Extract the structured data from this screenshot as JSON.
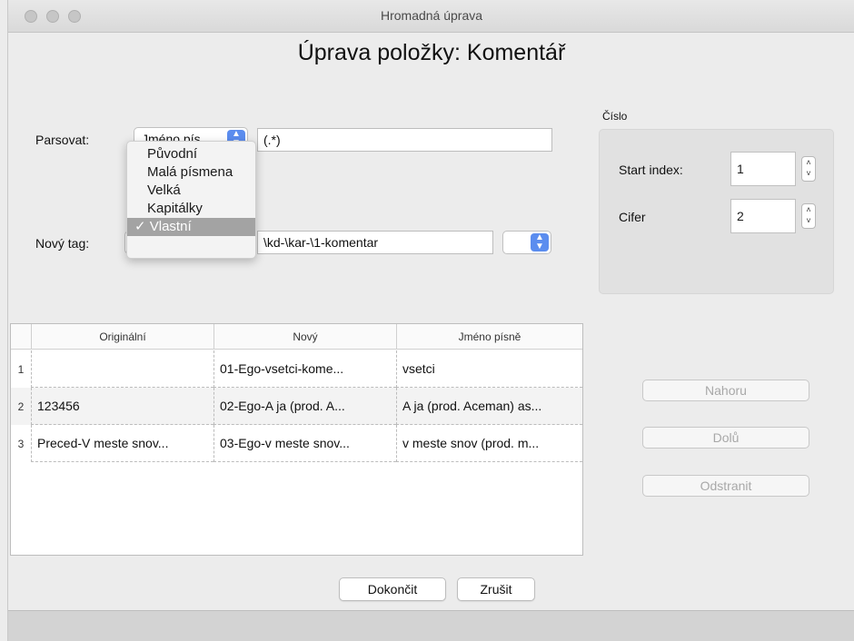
{
  "window": {
    "title": "Hromadná úprava"
  },
  "heading": "Úprava položky: Komentář",
  "parse": {
    "label": "Parsovat:",
    "popup_value": "Jméno pís",
    "pattern": "(.*)"
  },
  "newtag": {
    "label": "Nový tag:",
    "value": "\\kd-\\kar-\\1-komentar"
  },
  "case_menu": {
    "items": [
      "Původní",
      "Malá písmena",
      "Velká",
      "Kapitálky",
      "Vlastní"
    ],
    "selected": "Vlastní",
    "check": "✓"
  },
  "number_group": {
    "label": "Číslo",
    "start_label": "Start index:",
    "start_value": "1",
    "digits_label": "Cifer",
    "digits_value": "2"
  },
  "table": {
    "columns": [
      "Originální",
      "Nový",
      "Jméno písně"
    ],
    "rows": [
      {
        "num": "1",
        "orig": "",
        "new": "01-Ego-vsetci-kome...",
        "song": "vsetci"
      },
      {
        "num": "2",
        "orig": "123456",
        "new": "02-Ego-A ja (prod. A...",
        "song": "A ja (prod. Aceman) as..."
      },
      {
        "num": "3",
        "orig": "Preced-V meste snov...",
        "new": "03-Ego-v meste snov...",
        "song": "v meste snov (prod. m..."
      }
    ]
  },
  "side_buttons": {
    "up": "Nahoru",
    "down": "Dolů",
    "remove": "Odstranit"
  },
  "footer": {
    "finish": "Dokončit",
    "cancel": "Zrušit"
  },
  "colors": {
    "accent": "#5b8def",
    "menu_selected": "#a3a3a3",
    "disabled_text": "#a8a8a8"
  }
}
